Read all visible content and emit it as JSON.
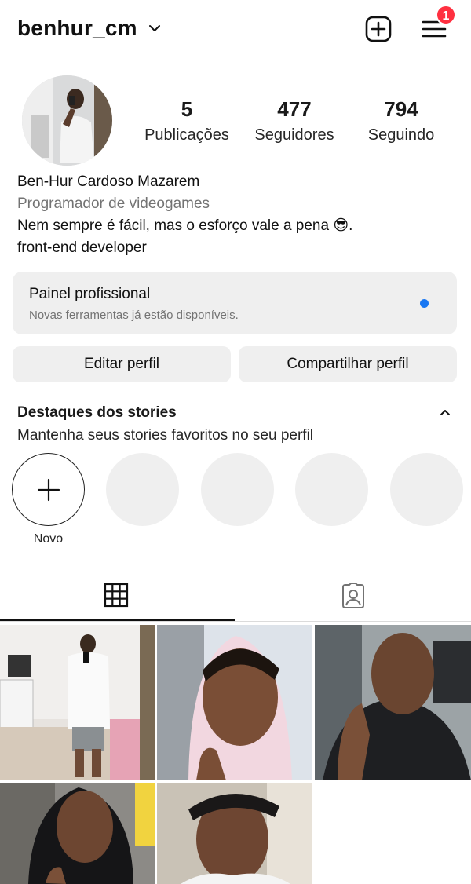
{
  "header": {
    "username": "benhur_cm",
    "menu_badge": "1"
  },
  "profile": {
    "stats": [
      {
        "value": "5",
        "label": "Publicações"
      },
      {
        "value": "477",
        "label": "Seguidores"
      },
      {
        "value": "794",
        "label": "Seguindo"
      }
    ],
    "name": "Ben-Hur Cardoso Mazarem",
    "category": "Programador de videogames",
    "bio_line1": "Nem sempre é fácil, mas o esforço vale a pena 😎.",
    "bio_line2": "front-end developer"
  },
  "dashboard": {
    "title": "Painel profissional",
    "subtitle": "Novas ferramentas já estão disponíveis."
  },
  "buttons": {
    "edit": "Editar perfil",
    "share": "Compartilhar perfil"
  },
  "highlights": {
    "title": "Destaques dos stories",
    "subtitle": "Mantenha seus stories favoritos no seu perfil",
    "new_label": "Novo"
  },
  "tabs": [
    "grid-icon",
    "tagged-icon"
  ],
  "colors": {
    "badge": "#ff3040",
    "dot": "#1877f2",
    "surface": "#efefef"
  }
}
